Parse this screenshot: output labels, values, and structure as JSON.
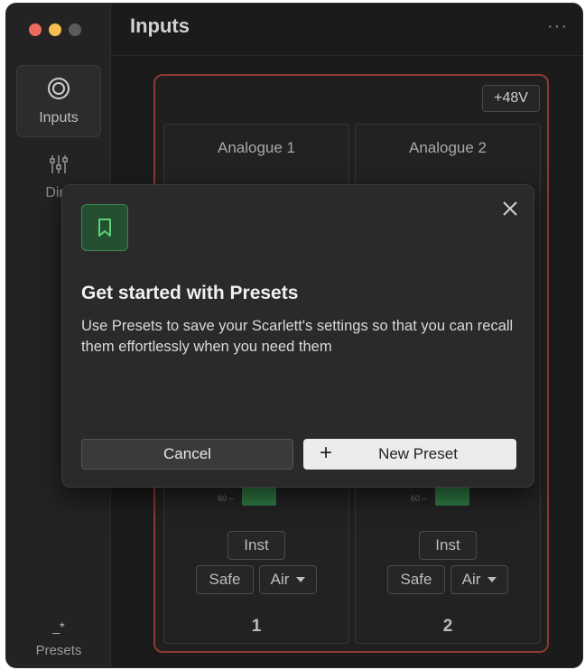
{
  "window": {
    "title": "Inputs",
    "more_label": "···"
  },
  "sidebar": {
    "items": [
      {
        "label": "Inputs",
        "icon": "input-ring-icon",
        "active": true
      },
      {
        "label": "Direct Monitor",
        "visible_label": "Dire",
        "icon": "mixer-sliders-icon",
        "active": false
      }
    ],
    "presets": {
      "label": "Presets",
      "icon_glyph": "_*"
    }
  },
  "inputs_panel": {
    "phantom_power_label": "+48V",
    "channels": [
      {
        "name": "Analogue 1",
        "meter_label": "60 –",
        "inst_label": "Inst",
        "safe_label": "Safe",
        "air_label": "Air",
        "number": "1"
      },
      {
        "name": "Analogue 2",
        "meter_label": "60 –",
        "inst_label": "Inst",
        "safe_label": "Safe",
        "air_label": "Air",
        "number": "2"
      }
    ]
  },
  "modal": {
    "title": "Get started with Presets",
    "body": "Use Presets to save your Scarlett's settings so that you can recall them effortlessly when you need them",
    "cancel_label": "Cancel",
    "new_preset_label": "New Preset",
    "icon": "bookmark-icon",
    "accent": "#3c8a52"
  },
  "colors": {
    "panel_border": "#8c3a33",
    "meter_green": "#2f7a43",
    "background": "#1b1b1c"
  }
}
